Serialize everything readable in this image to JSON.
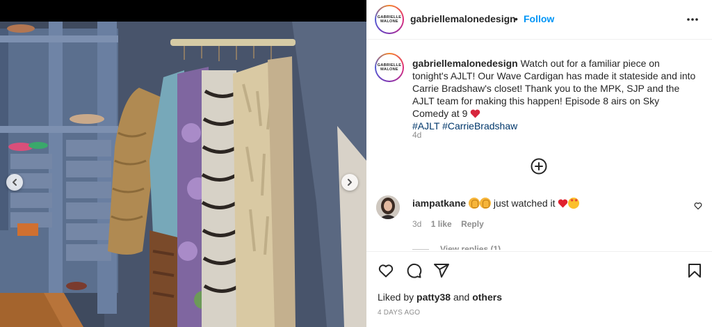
{
  "header": {
    "username": "gabriellemalonedesign",
    "separator": "•",
    "follow_label": "Follow",
    "avatar_logo_line1": "GABRIELLE",
    "avatar_logo_line2": "MALONE",
    "more_icon": "more-horizontal-icon"
  },
  "caption": {
    "username": "gabriellemalonedesign",
    "text": "Watch out for a familiar piece on tonight's AJLT! Our Wave Cardigan has made it stateside and into Carrie Bradshaw's closet! Thank you to the MPK, SJP and the AJLT team for making this happen! Episode 8 airs on Sky Comedy at 9",
    "emoji_icon": "heart-emoji",
    "hashtags": [
      "#AJLT",
      "#CarrieBradshaw"
    ],
    "time": "4d"
  },
  "load_more_icon": "plus-circle-icon",
  "comment": {
    "username": "iampatkane",
    "text": "just watched it",
    "emojis": [
      "clapping-hands",
      "clapping-hands",
      "red-heart",
      "star-struck"
    ],
    "time": "3d",
    "likes": "1 like",
    "reply_label": "Reply",
    "view_replies": "View replies (1)"
  },
  "actions": {
    "like_icon": "heart-icon",
    "comment_icon": "comment-icon",
    "share_icon": "paper-plane-icon",
    "save_icon": "bookmark-icon"
  },
  "likes": {
    "prefix": "Liked by",
    "user": "patty38",
    "and": "and",
    "others": "others"
  },
  "post_date": "4 DAYS AGO",
  "media": {
    "description_icon": "closet-photo",
    "prev_icon": "chevron-left-icon",
    "next_icon": "chevron-right-icon"
  },
  "colors": {
    "follow_blue": "#0095f6",
    "hashtag_blue": "#00376b",
    "muted_gray": "#8e8e8e",
    "heart_red": "#ed4956"
  }
}
